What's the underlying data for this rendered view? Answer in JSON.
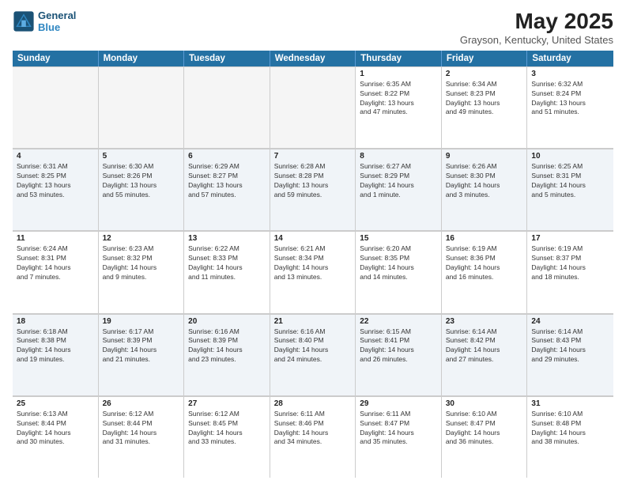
{
  "header": {
    "logo_line1": "General",
    "logo_line2": "Blue",
    "month_title": "May 2025",
    "location": "Grayson, Kentucky, United States"
  },
  "weekdays": [
    "Sunday",
    "Monday",
    "Tuesday",
    "Wednesday",
    "Thursday",
    "Friday",
    "Saturday"
  ],
  "rows": [
    [
      {
        "day": "",
        "empty": true
      },
      {
        "day": "",
        "empty": true
      },
      {
        "day": "",
        "empty": true
      },
      {
        "day": "",
        "empty": true
      },
      {
        "day": "1",
        "info": "Sunrise: 6:35 AM\nSunset: 8:22 PM\nDaylight: 13 hours\nand 47 minutes."
      },
      {
        "day": "2",
        "info": "Sunrise: 6:34 AM\nSunset: 8:23 PM\nDaylight: 13 hours\nand 49 minutes."
      },
      {
        "day": "3",
        "info": "Sunrise: 6:32 AM\nSunset: 8:24 PM\nDaylight: 13 hours\nand 51 minutes."
      }
    ],
    [
      {
        "day": "4",
        "info": "Sunrise: 6:31 AM\nSunset: 8:25 PM\nDaylight: 13 hours\nand 53 minutes."
      },
      {
        "day": "5",
        "info": "Sunrise: 6:30 AM\nSunset: 8:26 PM\nDaylight: 13 hours\nand 55 minutes."
      },
      {
        "day": "6",
        "info": "Sunrise: 6:29 AM\nSunset: 8:27 PM\nDaylight: 13 hours\nand 57 minutes."
      },
      {
        "day": "7",
        "info": "Sunrise: 6:28 AM\nSunset: 8:28 PM\nDaylight: 13 hours\nand 59 minutes."
      },
      {
        "day": "8",
        "info": "Sunrise: 6:27 AM\nSunset: 8:29 PM\nDaylight: 14 hours\nand 1 minute."
      },
      {
        "day": "9",
        "info": "Sunrise: 6:26 AM\nSunset: 8:30 PM\nDaylight: 14 hours\nand 3 minutes."
      },
      {
        "day": "10",
        "info": "Sunrise: 6:25 AM\nSunset: 8:31 PM\nDaylight: 14 hours\nand 5 minutes."
      }
    ],
    [
      {
        "day": "11",
        "info": "Sunrise: 6:24 AM\nSunset: 8:31 PM\nDaylight: 14 hours\nand 7 minutes."
      },
      {
        "day": "12",
        "info": "Sunrise: 6:23 AM\nSunset: 8:32 PM\nDaylight: 14 hours\nand 9 minutes."
      },
      {
        "day": "13",
        "info": "Sunrise: 6:22 AM\nSunset: 8:33 PM\nDaylight: 14 hours\nand 11 minutes."
      },
      {
        "day": "14",
        "info": "Sunrise: 6:21 AM\nSunset: 8:34 PM\nDaylight: 14 hours\nand 13 minutes."
      },
      {
        "day": "15",
        "info": "Sunrise: 6:20 AM\nSunset: 8:35 PM\nDaylight: 14 hours\nand 14 minutes."
      },
      {
        "day": "16",
        "info": "Sunrise: 6:19 AM\nSunset: 8:36 PM\nDaylight: 14 hours\nand 16 minutes."
      },
      {
        "day": "17",
        "info": "Sunrise: 6:19 AM\nSunset: 8:37 PM\nDaylight: 14 hours\nand 18 minutes."
      }
    ],
    [
      {
        "day": "18",
        "info": "Sunrise: 6:18 AM\nSunset: 8:38 PM\nDaylight: 14 hours\nand 19 minutes."
      },
      {
        "day": "19",
        "info": "Sunrise: 6:17 AM\nSunset: 8:39 PM\nDaylight: 14 hours\nand 21 minutes."
      },
      {
        "day": "20",
        "info": "Sunrise: 6:16 AM\nSunset: 8:39 PM\nDaylight: 14 hours\nand 23 minutes."
      },
      {
        "day": "21",
        "info": "Sunrise: 6:16 AM\nSunset: 8:40 PM\nDaylight: 14 hours\nand 24 minutes."
      },
      {
        "day": "22",
        "info": "Sunrise: 6:15 AM\nSunset: 8:41 PM\nDaylight: 14 hours\nand 26 minutes."
      },
      {
        "day": "23",
        "info": "Sunrise: 6:14 AM\nSunset: 8:42 PM\nDaylight: 14 hours\nand 27 minutes."
      },
      {
        "day": "24",
        "info": "Sunrise: 6:14 AM\nSunset: 8:43 PM\nDaylight: 14 hours\nand 29 minutes."
      }
    ],
    [
      {
        "day": "25",
        "info": "Sunrise: 6:13 AM\nSunset: 8:44 PM\nDaylight: 14 hours\nand 30 minutes."
      },
      {
        "day": "26",
        "info": "Sunrise: 6:12 AM\nSunset: 8:44 PM\nDaylight: 14 hours\nand 31 minutes."
      },
      {
        "day": "27",
        "info": "Sunrise: 6:12 AM\nSunset: 8:45 PM\nDaylight: 14 hours\nand 33 minutes."
      },
      {
        "day": "28",
        "info": "Sunrise: 6:11 AM\nSunset: 8:46 PM\nDaylight: 14 hours\nand 34 minutes."
      },
      {
        "day": "29",
        "info": "Sunrise: 6:11 AM\nSunset: 8:47 PM\nDaylight: 14 hours\nand 35 minutes."
      },
      {
        "day": "30",
        "info": "Sunrise: 6:10 AM\nSunset: 8:47 PM\nDaylight: 14 hours\nand 36 minutes."
      },
      {
        "day": "31",
        "info": "Sunrise: 6:10 AM\nSunset: 8:48 PM\nDaylight: 14 hours\nand 38 minutes."
      }
    ]
  ]
}
